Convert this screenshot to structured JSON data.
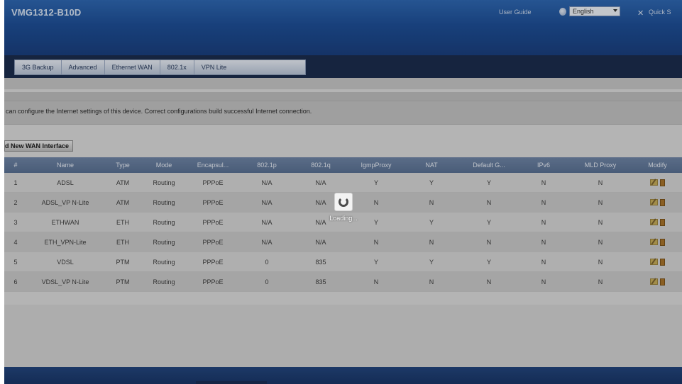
{
  "header": {
    "brand": "VMG1312-B10D",
    "user_guide": "User Guide",
    "language": "English",
    "quick": "Quick S"
  },
  "tabs": [
    {
      "label": "3G Backup"
    },
    {
      "label": "Advanced"
    },
    {
      "label": "Ethernet WAN"
    },
    {
      "label": "802.1x"
    },
    {
      "label": "VPN Lite"
    }
  ],
  "description": "can configure the Internet settings of this device. Correct configurations build successful Internet connection.",
  "add_button": "d New WAN Interface",
  "table": {
    "columns": [
      "#",
      "Name",
      "Type",
      "Mode",
      "Encapsul...",
      "802.1p",
      "802.1q",
      "IgmpProxy",
      "NAT",
      "Default G...",
      "IPv6",
      "MLD Proxy",
      "Modify"
    ],
    "rows": [
      {
        "n": "1",
        "name": "ADSL",
        "type": "ATM",
        "mode": "Routing",
        "encap": "PPPoE",
        "p": "N/A",
        "q": "N/A",
        "igmp": "Y",
        "nat": "Y",
        "dg": "Y",
        "ipv6": "N",
        "mld": "N"
      },
      {
        "n": "2",
        "name": "ADSL_VP N-Lite",
        "type": "ATM",
        "mode": "Routing",
        "encap": "PPPoE",
        "p": "N/A",
        "q": "N/A",
        "igmp": "N",
        "nat": "N",
        "dg": "N",
        "ipv6": "N",
        "mld": "N"
      },
      {
        "n": "3",
        "name": "ETHWAN",
        "type": "ETH",
        "mode": "Routing",
        "encap": "PPPoE",
        "p": "N/A",
        "q": "N/A",
        "igmp": "Y",
        "nat": "Y",
        "dg": "Y",
        "ipv6": "N",
        "mld": "N"
      },
      {
        "n": "4",
        "name": "ETH_VPN-Lite",
        "type": "ETH",
        "mode": "Routing",
        "encap": "PPPoE",
        "p": "N/A",
        "q": "N/A",
        "igmp": "N",
        "nat": "N",
        "dg": "N",
        "ipv6": "N",
        "mld": "N"
      },
      {
        "n": "5",
        "name": "VDSL",
        "type": "PTM",
        "mode": "Routing",
        "encap": "PPPoE",
        "p": "0",
        "q": "835",
        "igmp": "Y",
        "nat": "Y",
        "dg": "Y",
        "ipv6": "N",
        "mld": "N"
      },
      {
        "n": "6",
        "name": "VDSL_VP N-Lite",
        "type": "PTM",
        "mode": "Routing",
        "encap": "PPPoE",
        "p": "0",
        "q": "835",
        "igmp": "N",
        "nat": "N",
        "dg": "N",
        "ipv6": "N",
        "mld": "N"
      }
    ]
  },
  "loading": {
    "text": "Loading..."
  }
}
